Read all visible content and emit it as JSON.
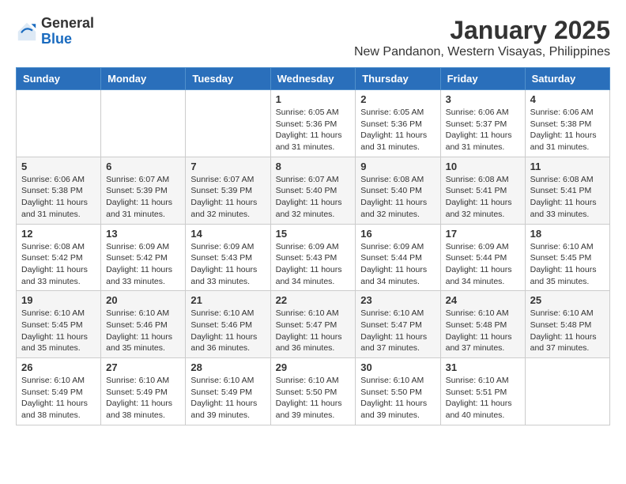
{
  "header": {
    "logo_general": "General",
    "logo_blue": "Blue",
    "title": "January 2025",
    "subtitle": "New Pandanon, Western Visayas, Philippines"
  },
  "weekdays": [
    "Sunday",
    "Monday",
    "Tuesday",
    "Wednesday",
    "Thursday",
    "Friday",
    "Saturday"
  ],
  "weeks": [
    [
      {
        "day": "",
        "info": ""
      },
      {
        "day": "",
        "info": ""
      },
      {
        "day": "",
        "info": ""
      },
      {
        "day": "1",
        "info": "Sunrise: 6:05 AM\nSunset: 5:36 PM\nDaylight: 11 hours and 31 minutes."
      },
      {
        "day": "2",
        "info": "Sunrise: 6:05 AM\nSunset: 5:36 PM\nDaylight: 11 hours and 31 minutes."
      },
      {
        "day": "3",
        "info": "Sunrise: 6:06 AM\nSunset: 5:37 PM\nDaylight: 11 hours and 31 minutes."
      },
      {
        "day": "4",
        "info": "Sunrise: 6:06 AM\nSunset: 5:38 PM\nDaylight: 11 hours and 31 minutes."
      }
    ],
    [
      {
        "day": "5",
        "info": "Sunrise: 6:06 AM\nSunset: 5:38 PM\nDaylight: 11 hours and 31 minutes."
      },
      {
        "day": "6",
        "info": "Sunrise: 6:07 AM\nSunset: 5:39 PM\nDaylight: 11 hours and 31 minutes."
      },
      {
        "day": "7",
        "info": "Sunrise: 6:07 AM\nSunset: 5:39 PM\nDaylight: 11 hours and 32 minutes."
      },
      {
        "day": "8",
        "info": "Sunrise: 6:07 AM\nSunset: 5:40 PM\nDaylight: 11 hours and 32 minutes."
      },
      {
        "day": "9",
        "info": "Sunrise: 6:08 AM\nSunset: 5:40 PM\nDaylight: 11 hours and 32 minutes."
      },
      {
        "day": "10",
        "info": "Sunrise: 6:08 AM\nSunset: 5:41 PM\nDaylight: 11 hours and 32 minutes."
      },
      {
        "day": "11",
        "info": "Sunrise: 6:08 AM\nSunset: 5:41 PM\nDaylight: 11 hours and 33 minutes."
      }
    ],
    [
      {
        "day": "12",
        "info": "Sunrise: 6:08 AM\nSunset: 5:42 PM\nDaylight: 11 hours and 33 minutes."
      },
      {
        "day": "13",
        "info": "Sunrise: 6:09 AM\nSunset: 5:42 PM\nDaylight: 11 hours and 33 minutes."
      },
      {
        "day": "14",
        "info": "Sunrise: 6:09 AM\nSunset: 5:43 PM\nDaylight: 11 hours and 33 minutes."
      },
      {
        "day": "15",
        "info": "Sunrise: 6:09 AM\nSunset: 5:43 PM\nDaylight: 11 hours and 34 minutes."
      },
      {
        "day": "16",
        "info": "Sunrise: 6:09 AM\nSunset: 5:44 PM\nDaylight: 11 hours and 34 minutes."
      },
      {
        "day": "17",
        "info": "Sunrise: 6:09 AM\nSunset: 5:44 PM\nDaylight: 11 hours and 34 minutes."
      },
      {
        "day": "18",
        "info": "Sunrise: 6:10 AM\nSunset: 5:45 PM\nDaylight: 11 hours and 35 minutes."
      }
    ],
    [
      {
        "day": "19",
        "info": "Sunrise: 6:10 AM\nSunset: 5:45 PM\nDaylight: 11 hours and 35 minutes."
      },
      {
        "day": "20",
        "info": "Sunrise: 6:10 AM\nSunset: 5:46 PM\nDaylight: 11 hours and 35 minutes."
      },
      {
        "day": "21",
        "info": "Sunrise: 6:10 AM\nSunset: 5:46 PM\nDaylight: 11 hours and 36 minutes."
      },
      {
        "day": "22",
        "info": "Sunrise: 6:10 AM\nSunset: 5:47 PM\nDaylight: 11 hours and 36 minutes."
      },
      {
        "day": "23",
        "info": "Sunrise: 6:10 AM\nSunset: 5:47 PM\nDaylight: 11 hours and 37 minutes."
      },
      {
        "day": "24",
        "info": "Sunrise: 6:10 AM\nSunset: 5:48 PM\nDaylight: 11 hours and 37 minutes."
      },
      {
        "day": "25",
        "info": "Sunrise: 6:10 AM\nSunset: 5:48 PM\nDaylight: 11 hours and 37 minutes."
      }
    ],
    [
      {
        "day": "26",
        "info": "Sunrise: 6:10 AM\nSunset: 5:49 PM\nDaylight: 11 hours and 38 minutes."
      },
      {
        "day": "27",
        "info": "Sunrise: 6:10 AM\nSunset: 5:49 PM\nDaylight: 11 hours and 38 minutes."
      },
      {
        "day": "28",
        "info": "Sunrise: 6:10 AM\nSunset: 5:49 PM\nDaylight: 11 hours and 39 minutes."
      },
      {
        "day": "29",
        "info": "Sunrise: 6:10 AM\nSunset: 5:50 PM\nDaylight: 11 hours and 39 minutes."
      },
      {
        "day": "30",
        "info": "Sunrise: 6:10 AM\nSunset: 5:50 PM\nDaylight: 11 hours and 39 minutes."
      },
      {
        "day": "31",
        "info": "Sunrise: 6:10 AM\nSunset: 5:51 PM\nDaylight: 11 hours and 40 minutes."
      },
      {
        "day": "",
        "info": ""
      }
    ]
  ]
}
